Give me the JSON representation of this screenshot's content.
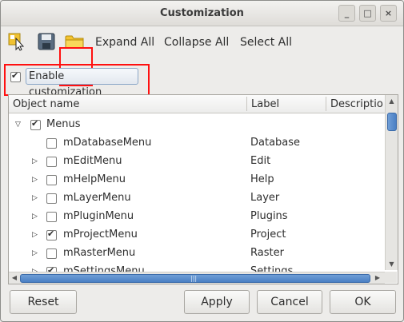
{
  "window": {
    "title": "Customization",
    "controls": {
      "minimize": "_",
      "maximize": "□",
      "close": "×"
    }
  },
  "toolbar": {
    "icons": [
      "pointer-select-icon",
      "save-disk-icon",
      "open-folder-icon"
    ],
    "expand_all": "Expand All",
    "collapse_all": "Collapse All",
    "select_all": "Select All"
  },
  "enable": {
    "label": "Enable customization",
    "checked": true
  },
  "tree": {
    "columns": [
      "Object name",
      "Label",
      "Descriptio"
    ],
    "rows": [
      {
        "name": "Menus",
        "label": "",
        "checked": true,
        "expander": "open"
      },
      {
        "name": "mDatabaseMenu",
        "label": "Database",
        "checked": false,
        "expander": "none"
      },
      {
        "name": "mEditMenu",
        "label": "Edit",
        "checked": false,
        "expander": "closed"
      },
      {
        "name": "mHelpMenu",
        "label": "Help",
        "checked": false,
        "expander": "closed"
      },
      {
        "name": "mLayerMenu",
        "label": "Layer",
        "checked": false,
        "expander": "closed"
      },
      {
        "name": "mPluginMenu",
        "label": "Plugins",
        "checked": false,
        "expander": "closed"
      },
      {
        "name": "mProjectMenu",
        "label": "Project",
        "checked": true,
        "expander": "closed"
      },
      {
        "name": "mRasterMenu",
        "label": "Raster",
        "checked": false,
        "expander": "closed"
      },
      {
        "name": "mSettingsMenu",
        "label": "Settings",
        "checked": true,
        "expander": "closed"
      }
    ]
  },
  "buttons": {
    "reset": "Reset",
    "apply": "Apply",
    "cancel": "Cancel",
    "ok": "OK"
  },
  "colors": {
    "highlight": "#ff1010",
    "selection": "#4a7fc4"
  }
}
